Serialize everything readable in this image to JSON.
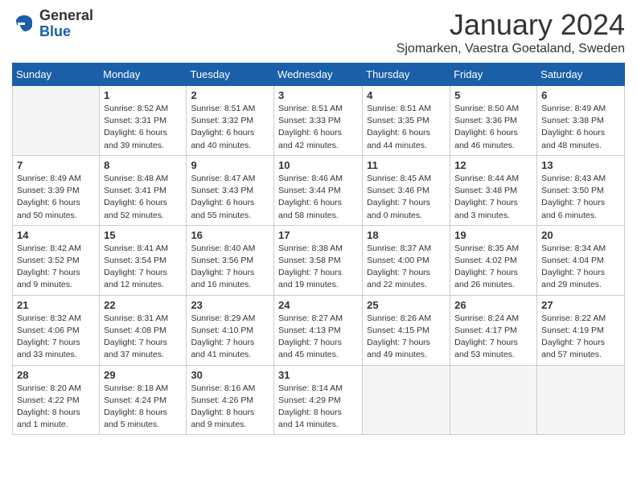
{
  "header": {
    "logo_general": "General",
    "logo_blue": "Blue",
    "month_title": "January 2024",
    "location": "Sjomarken, Vaestra Goetaland, Sweden"
  },
  "weekdays": [
    "Sunday",
    "Monday",
    "Tuesday",
    "Wednesday",
    "Thursday",
    "Friday",
    "Saturday"
  ],
  "weeks": [
    [
      {
        "day": "",
        "info": ""
      },
      {
        "day": "1",
        "info": "Sunrise: 8:52 AM\nSunset: 3:31 PM\nDaylight: 6 hours\nand 39 minutes."
      },
      {
        "day": "2",
        "info": "Sunrise: 8:51 AM\nSunset: 3:32 PM\nDaylight: 6 hours\nand 40 minutes."
      },
      {
        "day": "3",
        "info": "Sunrise: 8:51 AM\nSunset: 3:33 PM\nDaylight: 6 hours\nand 42 minutes."
      },
      {
        "day": "4",
        "info": "Sunrise: 8:51 AM\nSunset: 3:35 PM\nDaylight: 6 hours\nand 44 minutes."
      },
      {
        "day": "5",
        "info": "Sunrise: 8:50 AM\nSunset: 3:36 PM\nDaylight: 6 hours\nand 46 minutes."
      },
      {
        "day": "6",
        "info": "Sunrise: 8:49 AM\nSunset: 3:38 PM\nDaylight: 6 hours\nand 48 minutes."
      }
    ],
    [
      {
        "day": "7",
        "info": "Sunrise: 8:49 AM\nSunset: 3:39 PM\nDaylight: 6 hours\nand 50 minutes."
      },
      {
        "day": "8",
        "info": "Sunrise: 8:48 AM\nSunset: 3:41 PM\nDaylight: 6 hours\nand 52 minutes."
      },
      {
        "day": "9",
        "info": "Sunrise: 8:47 AM\nSunset: 3:43 PM\nDaylight: 6 hours\nand 55 minutes."
      },
      {
        "day": "10",
        "info": "Sunrise: 8:46 AM\nSunset: 3:44 PM\nDaylight: 6 hours\nand 58 minutes."
      },
      {
        "day": "11",
        "info": "Sunrise: 8:45 AM\nSunset: 3:46 PM\nDaylight: 7 hours\nand 0 minutes."
      },
      {
        "day": "12",
        "info": "Sunrise: 8:44 AM\nSunset: 3:48 PM\nDaylight: 7 hours\nand 3 minutes."
      },
      {
        "day": "13",
        "info": "Sunrise: 8:43 AM\nSunset: 3:50 PM\nDaylight: 7 hours\nand 6 minutes."
      }
    ],
    [
      {
        "day": "14",
        "info": "Sunrise: 8:42 AM\nSunset: 3:52 PM\nDaylight: 7 hours\nand 9 minutes."
      },
      {
        "day": "15",
        "info": "Sunrise: 8:41 AM\nSunset: 3:54 PM\nDaylight: 7 hours\nand 12 minutes."
      },
      {
        "day": "16",
        "info": "Sunrise: 8:40 AM\nSunset: 3:56 PM\nDaylight: 7 hours\nand 16 minutes."
      },
      {
        "day": "17",
        "info": "Sunrise: 8:38 AM\nSunset: 3:58 PM\nDaylight: 7 hours\nand 19 minutes."
      },
      {
        "day": "18",
        "info": "Sunrise: 8:37 AM\nSunset: 4:00 PM\nDaylight: 7 hours\nand 22 minutes."
      },
      {
        "day": "19",
        "info": "Sunrise: 8:35 AM\nSunset: 4:02 PM\nDaylight: 7 hours\nand 26 minutes."
      },
      {
        "day": "20",
        "info": "Sunrise: 8:34 AM\nSunset: 4:04 PM\nDaylight: 7 hours\nand 29 minutes."
      }
    ],
    [
      {
        "day": "21",
        "info": "Sunrise: 8:32 AM\nSunset: 4:06 PM\nDaylight: 7 hours\nand 33 minutes."
      },
      {
        "day": "22",
        "info": "Sunrise: 8:31 AM\nSunset: 4:08 PM\nDaylight: 7 hours\nand 37 minutes."
      },
      {
        "day": "23",
        "info": "Sunrise: 8:29 AM\nSunset: 4:10 PM\nDaylight: 7 hours\nand 41 minutes."
      },
      {
        "day": "24",
        "info": "Sunrise: 8:27 AM\nSunset: 4:13 PM\nDaylight: 7 hours\nand 45 minutes."
      },
      {
        "day": "25",
        "info": "Sunrise: 8:26 AM\nSunset: 4:15 PM\nDaylight: 7 hours\nand 49 minutes."
      },
      {
        "day": "26",
        "info": "Sunrise: 8:24 AM\nSunset: 4:17 PM\nDaylight: 7 hours\nand 53 minutes."
      },
      {
        "day": "27",
        "info": "Sunrise: 8:22 AM\nSunset: 4:19 PM\nDaylight: 7 hours\nand 57 minutes."
      }
    ],
    [
      {
        "day": "28",
        "info": "Sunrise: 8:20 AM\nSunset: 4:22 PM\nDaylight: 8 hours\nand 1 minute."
      },
      {
        "day": "29",
        "info": "Sunrise: 8:18 AM\nSunset: 4:24 PM\nDaylight: 8 hours\nand 5 minutes."
      },
      {
        "day": "30",
        "info": "Sunrise: 8:16 AM\nSunset: 4:26 PM\nDaylight: 8 hours\nand 9 minutes."
      },
      {
        "day": "31",
        "info": "Sunrise: 8:14 AM\nSunset: 4:29 PM\nDaylight: 8 hours\nand 14 minutes."
      },
      {
        "day": "",
        "info": ""
      },
      {
        "day": "",
        "info": ""
      },
      {
        "day": "",
        "info": ""
      }
    ]
  ]
}
